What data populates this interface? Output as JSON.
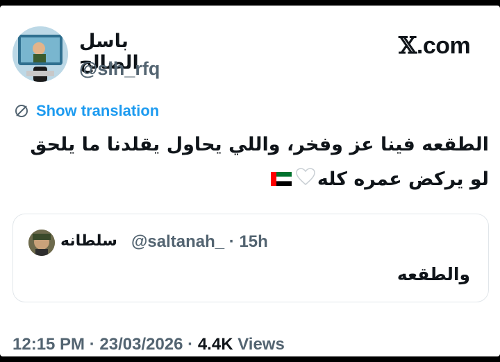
{
  "tweet": {
    "display_name": "باسل الصالح",
    "handle": "@slh_rfq",
    "site_label": ".com",
    "translation_label": "Show translation",
    "text_line1": "الطقعه فينا عز وفخر، واللي يحاول يقلدنا ما يلحق",
    "text_line2": "لو يركض عمره كله"
  },
  "quoted_tweet": {
    "display_name": "سلطانه",
    "meta": "@saltanah_ · 15h",
    "text": "والطقعه"
  },
  "footer": {
    "time_date": "12:15 PM · 23/03/2026 · ",
    "views_count": "4.4K",
    "views_label": " Views"
  },
  "icons": {
    "translate": "globe-slash-icon",
    "heart": "white-heart-emoji",
    "flag": "uae-flag-emoji"
  },
  "colors": {
    "link": "#1d9bf0",
    "secondary_text": "#536471",
    "primary_text": "#0f1419",
    "border": "#e1e6ea"
  }
}
